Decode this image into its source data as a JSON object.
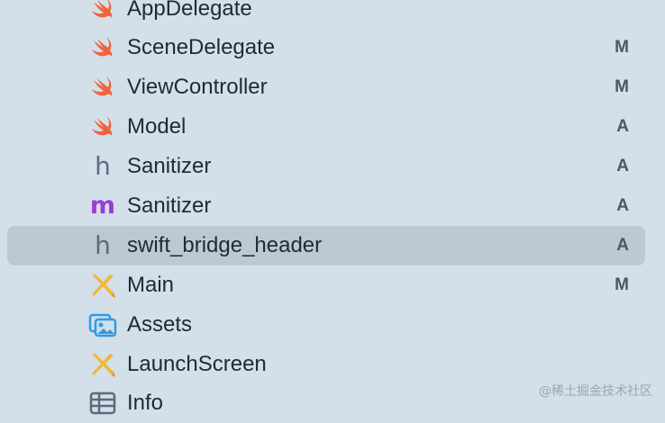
{
  "navigator": {
    "items": [
      {
        "name": "AppDelegate",
        "status": "",
        "icon": "swift-file-icon"
      },
      {
        "name": "SceneDelegate",
        "status": "M",
        "icon": "swift-file-icon"
      },
      {
        "name": "ViewController",
        "status": "M",
        "icon": "swift-file-icon"
      },
      {
        "name": "Model",
        "status": "A",
        "icon": "swift-file-icon"
      },
      {
        "name": "Sanitizer",
        "status": "A",
        "icon": "header-file-icon"
      },
      {
        "name": "Sanitizer",
        "status": "A",
        "icon": "objc-implementation-file-icon"
      },
      {
        "name": "swift_bridge_header",
        "status": "A",
        "icon": "header-file-icon",
        "selected": true
      },
      {
        "name": "Main",
        "status": "M",
        "icon": "storyboard-file-icon"
      },
      {
        "name": "Assets",
        "status": "",
        "icon": "asset-catalog-icon"
      },
      {
        "name": "LaunchScreen",
        "status": "",
        "icon": "storyboard-file-icon"
      },
      {
        "name": "Info",
        "status": "",
        "icon": "plist-file-icon"
      }
    ]
  },
  "icon_glyphs": {
    "header": "h",
    "implementation": "m"
  },
  "colors": {
    "background": "#d3dfe9",
    "selection": "#bdc8d2",
    "swift": "#f0643a",
    "objc_m": "#9b3bd6",
    "storyboard": "#f0b93a",
    "assets": "#2f9ae8"
  },
  "watermark": "@稀土掘金技术社区"
}
